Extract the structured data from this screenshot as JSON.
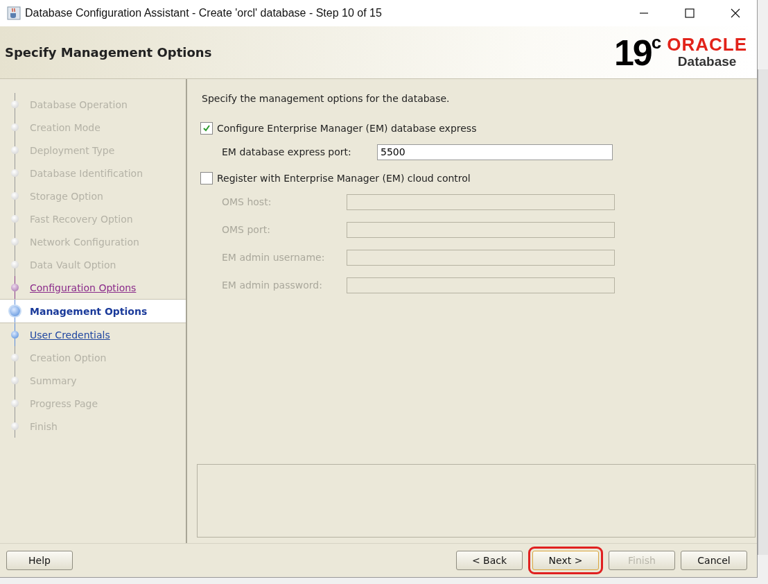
{
  "window": {
    "title": "Database Configuration Assistant - Create 'orcl' database - Step 10 of 15"
  },
  "header": {
    "title": "Specify Management Options",
    "logo": {
      "version": "19",
      "superscript": "c",
      "brand": "ORACLE",
      "product": "Database"
    }
  },
  "steps": [
    {
      "label": "Database Operation",
      "kind": "done",
      "selected": false
    },
    {
      "label": "Creation Mode",
      "kind": "done",
      "selected": false
    },
    {
      "label": "Deployment Type",
      "kind": "done",
      "selected": false
    },
    {
      "label": "Database Identification",
      "kind": "done",
      "selected": false
    },
    {
      "label": "Storage Option",
      "kind": "done",
      "selected": false
    },
    {
      "label": "Fast Recovery Option",
      "kind": "done",
      "selected": false
    },
    {
      "label": "Network Configuration",
      "kind": "done",
      "selected": false
    },
    {
      "label": "Data Vault Option",
      "kind": "done",
      "selected": false
    },
    {
      "label": "Configuration Options",
      "kind": "visited",
      "selected": false
    },
    {
      "label": "Management Options",
      "kind": "current",
      "selected": true
    },
    {
      "label": "User Credentials",
      "kind": "link",
      "selected": false
    },
    {
      "label": "Creation Option",
      "kind": "future",
      "selected": false
    },
    {
      "label": "Summary",
      "kind": "future",
      "selected": false
    },
    {
      "label": "Progress Page",
      "kind": "future",
      "selected": false
    },
    {
      "label": "Finish",
      "kind": "future",
      "selected": false
    }
  ],
  "content": {
    "intro": "Specify the management options for the database.",
    "options": [
      {
        "label": "Configure Enterprise Manager (EM) database express",
        "checked": true,
        "fields": [
          {
            "label": "EM database express port:",
            "value": "5500",
            "disabled": false
          }
        ]
      },
      {
        "label": "Register with Enterprise Manager (EM) cloud control",
        "checked": false,
        "fields": [
          {
            "label": "OMS host:",
            "disabled": true
          },
          {
            "label": "OMS port:",
            "disabled": true
          },
          {
            "label": "EM admin username:",
            "disabled": true
          },
          {
            "label": "EM admin password:",
            "disabled": true
          }
        ]
      }
    ]
  },
  "buttons": [
    {
      "label": "Help",
      "kind": "left",
      "disabled": false,
      "highlighted": false
    },
    {
      "label": "< Back",
      "kind": "right",
      "disabled": false,
      "highlighted": false
    },
    {
      "label": "Next >",
      "kind": "right",
      "disabled": false,
      "highlighted": true
    },
    {
      "label": "Finish",
      "kind": "right",
      "disabled": true,
      "highlighted": false
    },
    {
      "label": "Cancel",
      "kind": "right",
      "disabled": false,
      "highlighted": false
    }
  ]
}
